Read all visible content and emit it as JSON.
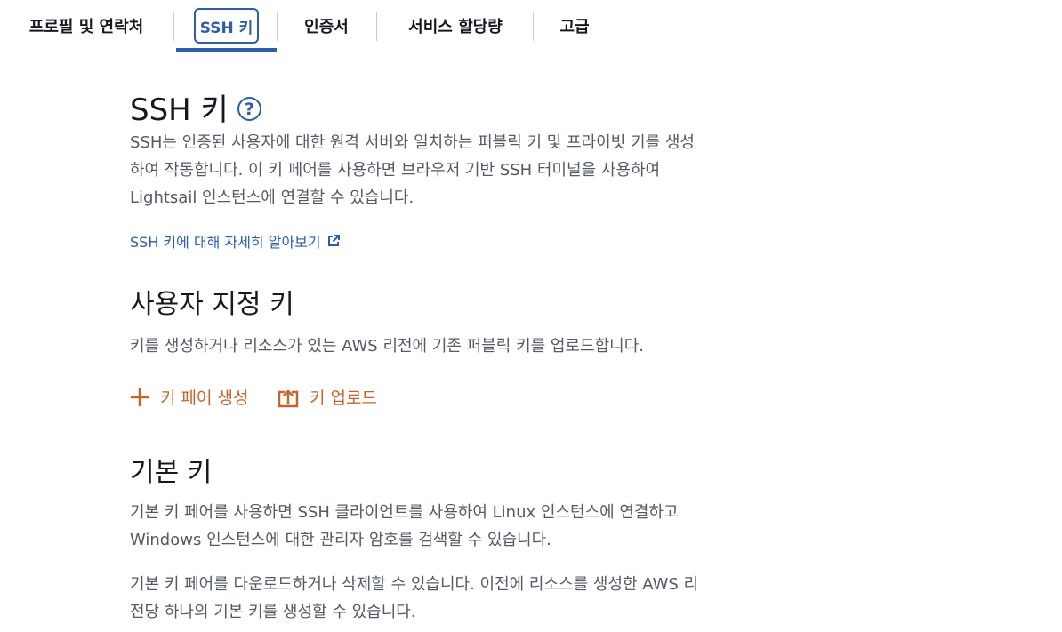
{
  "tabs": [
    {
      "label": "프로필 및 연락처"
    },
    {
      "label": "SSH 키"
    },
    {
      "label": "인증서"
    },
    {
      "label": "서비스 할당량"
    },
    {
      "label": "고급"
    }
  ],
  "ssh": {
    "title": "SSH 키",
    "help_symbol": "?",
    "desc_lines": [
      "SSH는 인증된 사용자에 대한 원격 서버와 일치하는 퍼블릭 키 및 프라이빗 키를 생성",
      "하여 작동합니다. 이 키 페어를 사용하면 브라우저 기반 SSH 터미널을 사용하여",
      "Lightsail 인스턴스에 연결할 수 있습니다."
    ],
    "learn_more": "SSH 키에 대해 자세히 알아보기"
  },
  "custom": {
    "title": "사용자 지정 키",
    "desc": "키를 생성하거나 리소스가 있는 AWS 리전에 기존 퍼블릭 키를 업로드합니다.",
    "create_label": "키 페어 생성",
    "upload_label": "키 업로드"
  },
  "default": {
    "title": "기본 키",
    "desc1_lines": [
      "기본 키 페어를 사용하면 SSH 클라이언트를 사용하여 Linux 인스턴스에 연결하고",
      "Windows 인스턴스에 대한 관리자 암호를 검색할 수 있습니다."
    ],
    "desc2_lines": [
      "기본 키 페어를 다운로드하거나 삭제할 수 있습니다. 이전에 리소스를 생성한 AWS 리",
      "전당 하나의 기본 키를 생성할 수 있습니다."
    ]
  },
  "colors": {
    "accent": "#2e5ea8",
    "action": "#c4652d",
    "body_text": "#545b64"
  },
  "icons": {
    "help": "help-circle-icon",
    "external": "external-link-icon",
    "add": "plus-icon",
    "upload": "upload-icon"
  }
}
